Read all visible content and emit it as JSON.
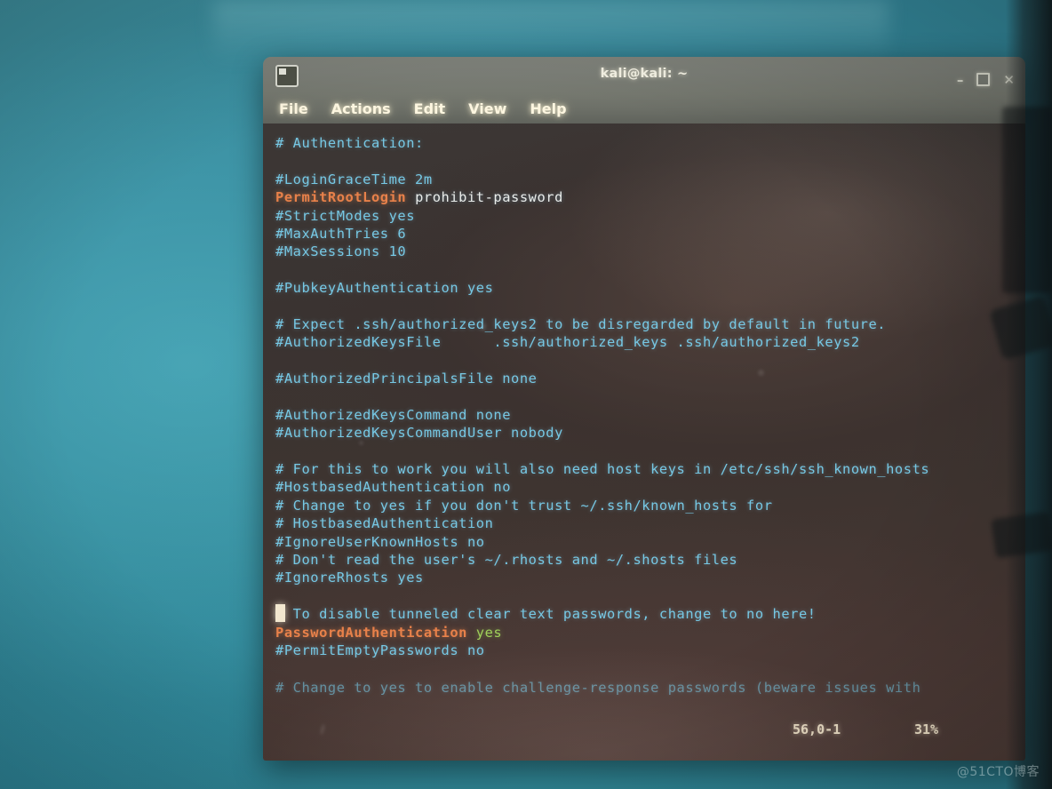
{
  "desktop": {
    "background_color": "#2f8395",
    "watermark": "@51CTO博客"
  },
  "window": {
    "title": "kali@kali: ~",
    "icon": "terminal-icon",
    "controls": {
      "minimize": "–",
      "maximize": "□",
      "close": "✕"
    },
    "menu": [
      {
        "label": "File"
      },
      {
        "label": "Actions"
      },
      {
        "label": "Edit"
      },
      {
        "label": "View"
      },
      {
        "label": "Help"
      }
    ]
  },
  "editor": {
    "app": "vim",
    "file_hint": "/etc/ssh/sshd_config",
    "colors": {
      "comment": "#76c8e4",
      "keyword": "#e8814a",
      "value": "#e9ecea",
      "green_value": "#9fd05a",
      "background": "#3a3331",
      "cursor": "#f2e7cf"
    },
    "cursor_line_index": 26,
    "status": {
      "ruler": "56,0-1",
      "percent": "31%"
    },
    "lines": [
      {
        "segments": [
          {
            "text": "# Authentication:",
            "style": "comment"
          }
        ]
      },
      {
        "segments": []
      },
      {
        "segments": [
          {
            "text": "#LoginGraceTime 2m",
            "style": "comment"
          }
        ]
      },
      {
        "segments": [
          {
            "text": "PermitRootLogin",
            "style": "keyword"
          },
          {
            "text": " prohibit-password",
            "style": "value"
          }
        ]
      },
      {
        "segments": [
          {
            "text": "#StrictModes yes",
            "style": "comment"
          }
        ]
      },
      {
        "segments": [
          {
            "text": "#MaxAuthTries 6",
            "style": "comment"
          }
        ]
      },
      {
        "segments": [
          {
            "text": "#MaxSessions 10",
            "style": "comment"
          }
        ]
      },
      {
        "segments": []
      },
      {
        "segments": [
          {
            "text": "#PubkeyAuthentication yes",
            "style": "comment"
          }
        ]
      },
      {
        "segments": []
      },
      {
        "segments": [
          {
            "text": "# Expect .ssh/authorized_keys2 to be disregarded by default in future.",
            "style": "comment"
          }
        ]
      },
      {
        "segments": [
          {
            "text": "#AuthorizedKeysFile\t.ssh/authorized_keys .ssh/authorized_keys2",
            "style": "comment"
          }
        ]
      },
      {
        "segments": []
      },
      {
        "segments": [
          {
            "text": "#AuthorizedPrincipalsFile none",
            "style": "comment"
          }
        ]
      },
      {
        "segments": []
      },
      {
        "segments": [
          {
            "text": "#AuthorizedKeysCommand none",
            "style": "comment"
          }
        ]
      },
      {
        "segments": [
          {
            "text": "#AuthorizedKeysCommandUser nobody",
            "style": "comment"
          }
        ]
      },
      {
        "segments": []
      },
      {
        "segments": [
          {
            "text": "# For this to work you will also need host keys in /etc/ssh/ssh_known_hosts",
            "style": "comment"
          }
        ]
      },
      {
        "segments": [
          {
            "text": "#HostbasedAuthentication no",
            "style": "comment"
          }
        ]
      },
      {
        "segments": [
          {
            "text": "# Change to yes if you don't trust ~/.ssh/known_hosts for",
            "style": "comment"
          }
        ]
      },
      {
        "segments": [
          {
            "text": "# HostbasedAuthentication",
            "style": "comment"
          }
        ]
      },
      {
        "segments": [
          {
            "text": "#IgnoreUserKnownHosts no",
            "style": "comment"
          }
        ]
      },
      {
        "segments": [
          {
            "text": "# Don't read the user's ~/.rhosts and ~/.shosts files",
            "style": "comment"
          }
        ]
      },
      {
        "segments": [
          {
            "text": "#IgnoreRhosts yes",
            "style": "comment"
          }
        ]
      },
      {
        "segments": []
      },
      {
        "segments": [
          {
            "text": "# To disable tunneled clear text passwords, change to no here!",
            "style": "comment"
          }
        ]
      },
      {
        "segments": [
          {
            "text": "PasswordAuthentication",
            "style": "keyword"
          },
          {
            "text": " yes",
            "style": "green"
          }
        ]
      },
      {
        "segments": [
          {
            "text": "#PermitEmptyPasswords no",
            "style": "comment"
          }
        ]
      },
      {
        "segments": []
      },
      {
        "segments": [
          {
            "text": "# Change to yes to enable challenge-response passwords (beware issues with",
            "style": "comment"
          }
        ]
      }
    ]
  }
}
